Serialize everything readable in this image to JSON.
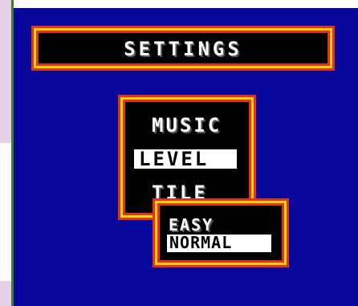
{
  "screen": {
    "title": "SETTINGS",
    "menu": {
      "items": [
        "MUSIC",
        "LEVEL",
        "TILE"
      ],
      "selected": "LEVEL"
    },
    "submenu": {
      "options": [
        "EASY",
        "NORMAL"
      ],
      "selected": "NORMAL"
    }
  },
  "colors": {
    "background": "#07079c",
    "frame_outer": "#e2321b",
    "frame_mid": "#ffd400",
    "box": "#000000",
    "text": "#ffffff"
  }
}
